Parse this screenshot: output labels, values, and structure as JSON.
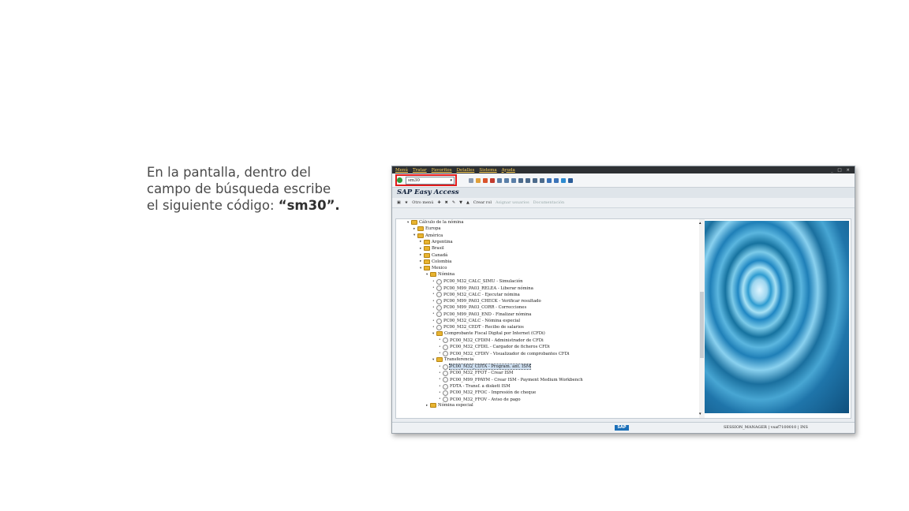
{
  "instruction": {
    "line1": "En la pantalla, dentro del",
    "line2": "campo de búsqueda escribe",
    "line3_prefix": "el siguiente código: ",
    "line3_code": "“sm30”."
  },
  "sap": {
    "menus": [
      "Menú",
      "Tratar",
      "Favoritos",
      "Detalles",
      "Sistema",
      "Ayuda"
    ],
    "window_controls": "_ □ ×",
    "command_field_value": "sm30",
    "highlight_color": "#e21b1b",
    "screen_title": "SAP Easy Access",
    "app_toolbar": {
      "other_menu": "Otro menú",
      "create_role": "Crear rol",
      "assign_users": "Asignar usuarios",
      "documentation": "Documentación"
    },
    "tree": [
      {
        "label": "Cálculo de la nómina",
        "level": 0,
        "type": "folder",
        "expanded": true
      },
      {
        "label": "Europa",
        "level": 1,
        "type": "folder",
        "expanded": false
      },
      {
        "label": "América",
        "level": 1,
        "type": "folder",
        "expanded": true
      },
      {
        "label": "Argentina",
        "level": 2,
        "type": "folder",
        "expanded": false
      },
      {
        "label": "Brasil",
        "level": 2,
        "type": "folder",
        "expanded": false
      },
      {
        "label": "Canadá",
        "level": 2,
        "type": "folder",
        "expanded": false
      },
      {
        "label": "Colombia",
        "level": 2,
        "type": "folder",
        "expanded": false
      },
      {
        "label": "Mexico",
        "level": 2,
        "type": "folder",
        "expanded": true
      },
      {
        "label": "Nómina",
        "level": 3,
        "type": "folder",
        "expanded": true
      },
      {
        "label": "PC00_M32_CALC_SIMU - Simulación",
        "level": 4,
        "type": "tx"
      },
      {
        "label": "PC00_M99_PA03_RELEA - Liberar nómina",
        "level": 4,
        "type": "tx"
      },
      {
        "label": "PC00_M32_CALC - Ejecutar nómina",
        "level": 4,
        "type": "tx"
      },
      {
        "label": "PC00_M99_PA03_CHECK - Verificar resultado",
        "level": 4,
        "type": "tx"
      },
      {
        "label": "PC00_M99_PA03_CORR - Correcciones",
        "level": 4,
        "type": "tx"
      },
      {
        "label": "PC00_M99_PA03_END - Finalizar nómina",
        "level": 4,
        "type": "tx"
      },
      {
        "label": "PC00_M32_CALC - Nómina especial",
        "level": 4,
        "type": "tx"
      },
      {
        "label": "PC00_M32_CEDT - Recibo de salarios",
        "level": 4,
        "type": "tx"
      },
      {
        "label": "Comprobante Fiscal Digital por Internet (CFDi)",
        "level": 4,
        "type": "folder",
        "expanded": true
      },
      {
        "label": "PC00_M32_CFDIM - Administrador de CFDi",
        "level": 5,
        "type": "tx"
      },
      {
        "label": "PC00_M32_CFDIL - Cargador de ficheros CFDi",
        "level": 5,
        "type": "tx"
      },
      {
        "label": "PC00_M32_CFDIV - Visualizador de comprobantes CFDi",
        "level": 5,
        "type": "tx"
      },
      {
        "label": "Transferencia",
        "level": 4,
        "type": "folder",
        "expanded": true
      },
      {
        "label": "PC00_M32_CDTA - Program. ant. ISM",
        "level": 5,
        "type": "tx",
        "selected": true
      },
      {
        "label": "PC00_M32_FFOT - Crear ISM",
        "level": 5,
        "type": "tx"
      },
      {
        "label": "PC00_M99_FPAYM - Crear ISM - Payment Medium Workbench",
        "level": 5,
        "type": "tx"
      },
      {
        "label": "FDTA - Transf. a diskett ISM",
        "level": 5,
        "type": "tx"
      },
      {
        "label": "PC00_M32_FFOC - Impresión de cheque",
        "level": 5,
        "type": "tx"
      },
      {
        "label": "PC00_M32_FFOV - Aviso de pago",
        "level": 5,
        "type": "tx"
      },
      {
        "label": "Nómina especial",
        "level": 3,
        "type": "folder",
        "expanded": false
      }
    ],
    "sap_logo": "SAP",
    "status": {
      "session": "SESSION_MANAGER",
      "server": "vsaf7100010",
      "mode": "INS"
    }
  }
}
